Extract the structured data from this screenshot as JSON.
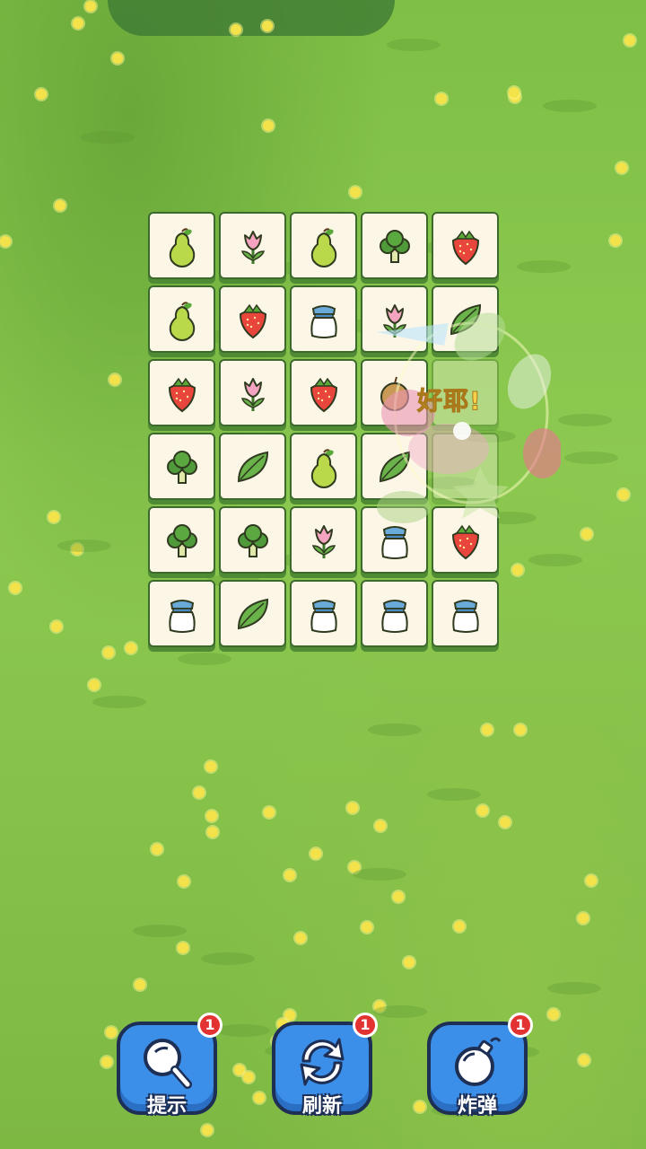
{
  "board": {
    "rows": [
      [
        "pear-icon",
        "tulip-icon",
        "pear-icon",
        "broccoli-icon",
        "strawberry-icon"
      ],
      [
        "pear-icon",
        "strawberry-icon",
        "milk-jar-icon",
        "tulip-icon",
        "leaf-icon"
      ],
      [
        "strawberry-icon",
        "tulip-icon",
        "strawberry-icon",
        "apple-icon",
        ""
      ],
      [
        "broccoli-icon",
        "leaf-icon",
        "pear-icon",
        "leaf-icon",
        ""
      ],
      [
        "broccoli-icon",
        "broccoli-icon",
        "tulip-icon",
        "milk-jar-icon",
        "strawberry-icon"
      ],
      [
        "milk-jar-icon",
        "leaf-icon",
        "milk-jar-icon",
        "milk-jar-icon",
        "milk-jar-icon"
      ]
    ]
  },
  "match_popup": {
    "text": "好耶!"
  },
  "tools": {
    "hint": {
      "label": "提示",
      "count": "1",
      "icon": "magnifier-icon"
    },
    "refresh": {
      "label": "刷新",
      "count": "1",
      "icon": "refresh-icon"
    },
    "bomb": {
      "label": "炸弹",
      "count": "1",
      "icon": "bomb-icon"
    }
  },
  "colors": {
    "button": "#3c8fe8",
    "badge": "#e23232",
    "tile": "#fbf6e6",
    "grass": "#86c24a"
  }
}
